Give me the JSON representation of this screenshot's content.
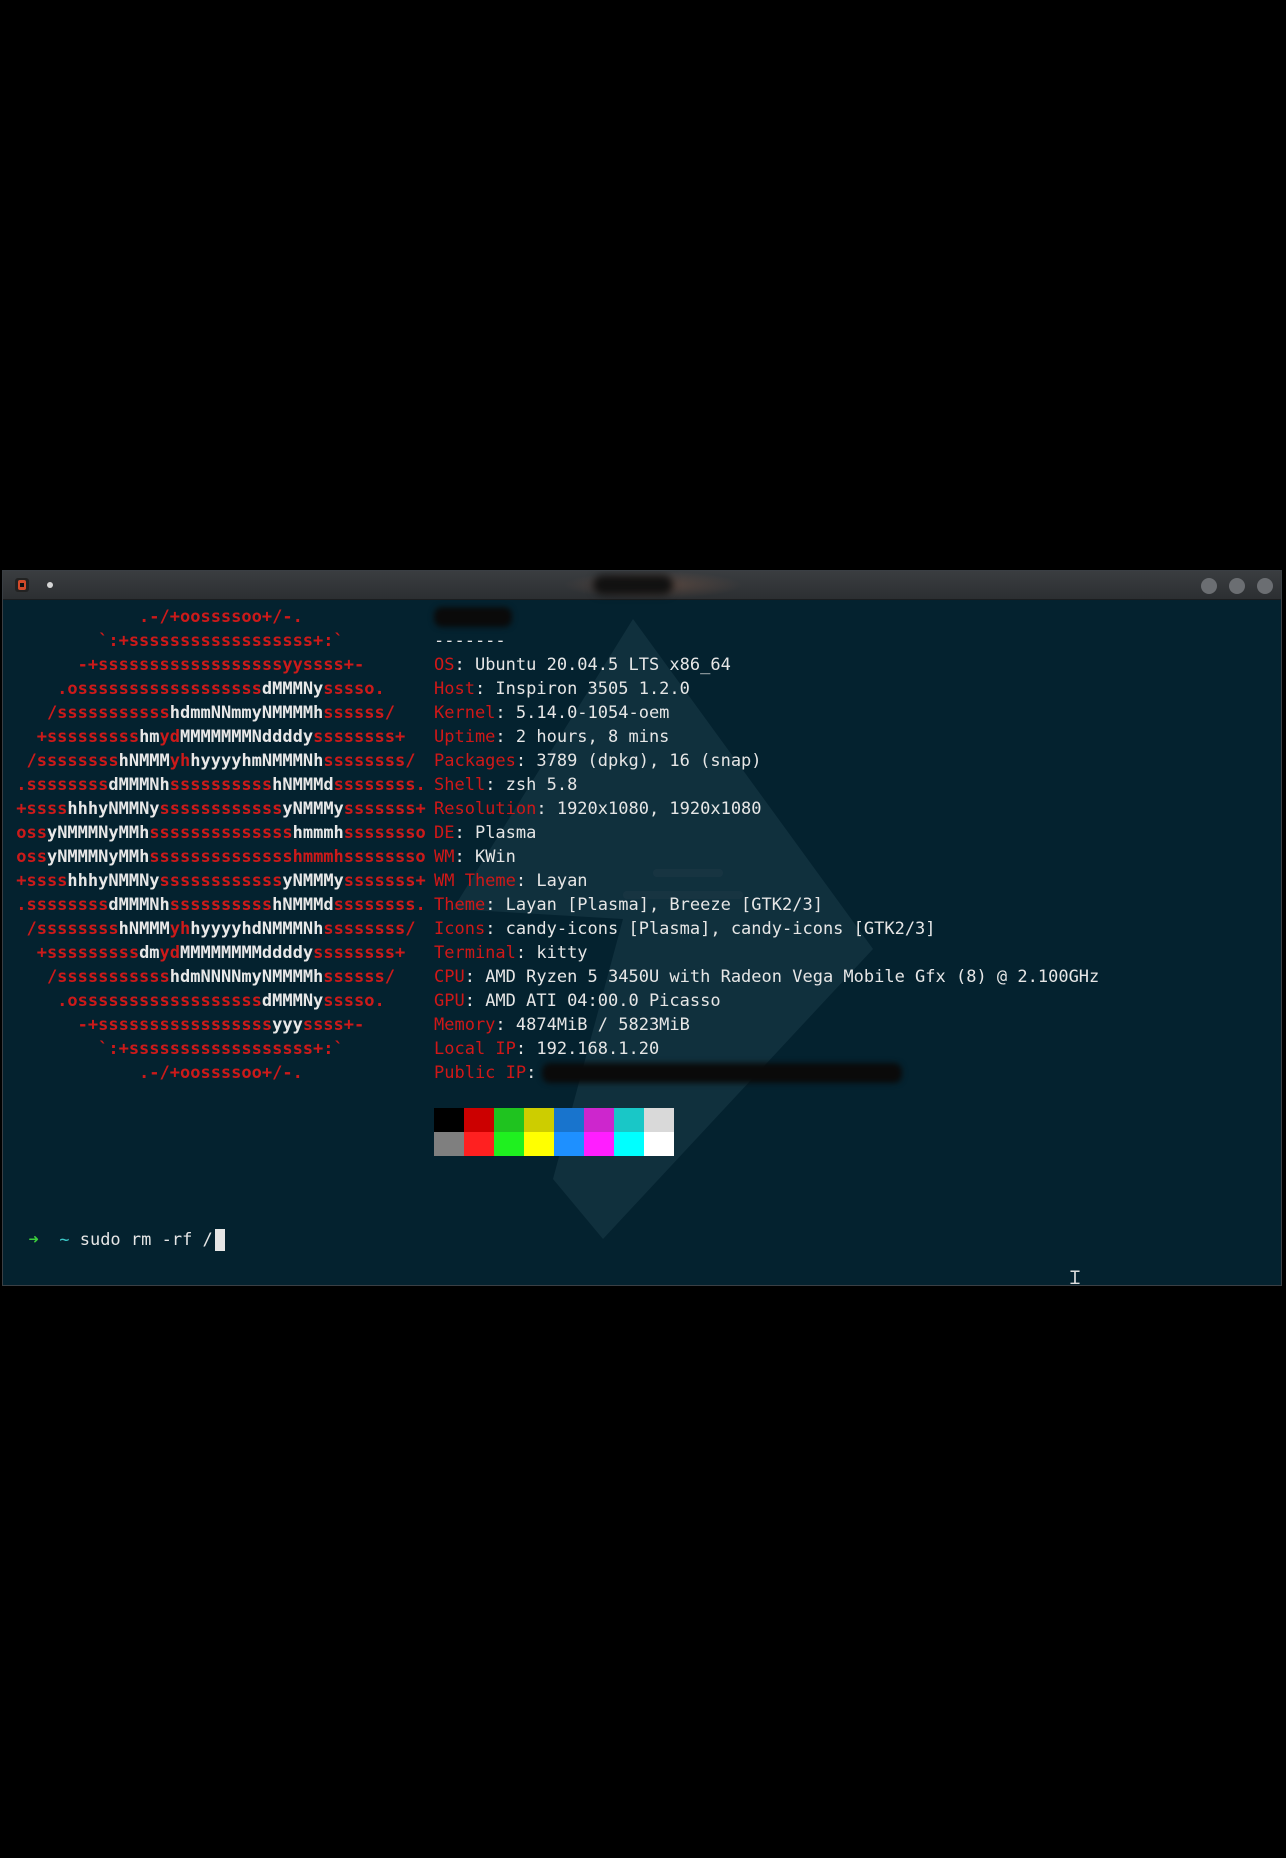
{
  "window": {
    "title": "",
    "controls": [
      "minimize",
      "maximize",
      "close"
    ]
  },
  "ascii_logo": [
    [
      [
        "r",
        "             .-/+oossssoo+/-."
      ]
    ],
    [
      [
        "r",
        "         `:+ssssssssssssssssss+:`"
      ]
    ],
    [
      [
        "r",
        "       -+ssssssssssssssssssyyssss+-"
      ]
    ],
    [
      [
        "r",
        "     .ossssssssssssssssss"
      ],
      [
        "w",
        "dMMMNy"
      ],
      [
        "r",
        "sssso."
      ]
    ],
    [
      [
        "r",
        "    /sssssssssss"
      ],
      [
        "w",
        "hdmmNNmmyNMMMMh"
      ],
      [
        "r",
        "ssssss/"
      ]
    ],
    [
      [
        "r",
        "   +sssssssss"
      ],
      [
        "w",
        "hm"
      ],
      [
        "r",
        "yd"
      ],
      [
        "w",
        "MMMMMMMNddddy"
      ],
      [
        "r",
        "ssssssss+"
      ]
    ],
    [
      [
        "r",
        "  /ssssssss"
      ],
      [
        "w",
        "hNMMM"
      ],
      [
        "r",
        "yh"
      ],
      [
        "w",
        "hyyyyhmNMMMNh"
      ],
      [
        "r",
        "ssssssss/"
      ]
    ],
    [
      [
        "r",
        " .ssssssss"
      ],
      [
        "w",
        "dMMMNh"
      ],
      [
        "r",
        "ssssssssss"
      ],
      [
        "w",
        "hNMMMd"
      ],
      [
        "r",
        "ssssssss."
      ]
    ],
    [
      [
        "r",
        " +ssss"
      ],
      [
        "w",
        "hhhyNMMNy"
      ],
      [
        "r",
        "ssssssssssss"
      ],
      [
        "w",
        "yNMMMy"
      ],
      [
        "r",
        "sssssss+"
      ]
    ],
    [
      [
        "r",
        " oss"
      ],
      [
        "w",
        "yNMMMNyMMh"
      ],
      [
        "r",
        "ssssssssssssss"
      ],
      [
        "w",
        "hmmmh"
      ],
      [
        "r",
        "ssssssso"
      ]
    ],
    [
      [
        "r",
        " oss"
      ],
      [
        "w",
        "yNMMMNyMMh"
      ],
      [
        "r",
        "sssssssssssssshmmmhssssssso"
      ]
    ],
    [
      [
        "r",
        " +ssss"
      ],
      [
        "w",
        "hhhyNMMNy"
      ],
      [
        "r",
        "ssssssssssss"
      ],
      [
        "w",
        "yNMMMy"
      ],
      [
        "r",
        "sssssss+"
      ]
    ],
    [
      [
        "r",
        " .ssssssss"
      ],
      [
        "w",
        "dMMMNh"
      ],
      [
        "r",
        "ssssssssss"
      ],
      [
        "w",
        "hNMMMd"
      ],
      [
        "r",
        "ssssssss."
      ]
    ],
    [
      [
        "r",
        "  /ssssssss"
      ],
      [
        "w",
        "hNMMM"
      ],
      [
        "r",
        "yh"
      ],
      [
        "w",
        "hyyyyhdNMMMNh"
      ],
      [
        "r",
        "ssssssss/"
      ]
    ],
    [
      [
        "r",
        "   +sssssssss"
      ],
      [
        "w",
        "dm"
      ],
      [
        "r",
        "yd"
      ],
      [
        "w",
        "MMMMMMMMddddy"
      ],
      [
        "r",
        "ssssssss+"
      ]
    ],
    [
      [
        "r",
        "    /sssssssssss"
      ],
      [
        "w",
        "hdmNNNNmyNMMMMh"
      ],
      [
        "r",
        "ssssss/"
      ]
    ],
    [
      [
        "r",
        "     .ossssssssssssssssss"
      ],
      [
        "w",
        "dMMMNy"
      ],
      [
        "r",
        "sssso."
      ]
    ],
    [
      [
        "r",
        "       -+sssssssssssssssss"
      ],
      [
        "w",
        "yyy"
      ],
      [
        "r",
        "ssss+-"
      ]
    ],
    [
      [
        "r",
        "         `:+ssssssssssssssssss+:`"
      ]
    ],
    [
      [
        "r",
        "             .-/+oossssoo+/-."
      ]
    ]
  ],
  "info": {
    "separator": "-------",
    "rows": [
      {
        "key": "OS",
        "value": ": Ubuntu 20.04.5 LTS x86_64"
      },
      {
        "key": "Host",
        "value": ": Inspiron 3505 1.2.0"
      },
      {
        "key": "Kernel",
        "value": ": 5.14.0-1054-oem"
      },
      {
        "key": "Uptime",
        "value": ": 2 hours, 8 mins"
      },
      {
        "key": "Packages",
        "value": ": 3789 (dpkg), 16 (snap)"
      },
      {
        "key": "Shell",
        "value": ": zsh 5.8"
      },
      {
        "key": "Resolution",
        "value": ": 1920x1080, 1920x1080"
      },
      {
        "key": "DE",
        "value": ": Plasma"
      },
      {
        "key": "WM",
        "value": ": KWin"
      },
      {
        "key": "WM Theme",
        "value": ": Layan"
      },
      {
        "key": "Theme",
        "value": ": Layan [Plasma], Breeze [GTK2/3]"
      },
      {
        "key": "Icons",
        "value": ": candy-icons [Plasma], candy-icons [GTK2/3]"
      },
      {
        "key": "Terminal",
        "value": ": kitty"
      },
      {
        "key": "CPU",
        "value": ": AMD Ryzen 5 3450U with Radeon Vega Mobile Gfx (8) @ 2.100GHz"
      },
      {
        "key": "GPU",
        "value": ": AMD ATI 04:00.0 Picasso"
      },
      {
        "key": "Memory",
        "value": ": 4874MiB / 5823MiB"
      },
      {
        "key": "Local IP",
        "value": ": 192.168.1.20"
      },
      {
        "key": "Public IP",
        "value": ":"
      }
    ]
  },
  "palette": {
    "normal": [
      "#000000",
      "#cc0000",
      "#1fc31f",
      "#cdcd00",
      "#1874cd",
      "#cd26cd",
      "#19c7c7",
      "#d9d9d9"
    ],
    "bright": [
      "#7f7f7f",
      "#ff2020",
      "#1ff01f",
      "#ffff00",
      "#1e90ff",
      "#ff1eff",
      "#00ffff",
      "#ffffff"
    ]
  },
  "prompt": {
    "arrow": "➜",
    "dir": "~",
    "command": "sudo rm -rf /"
  },
  "colors": {
    "terminal_bg": "#04222f",
    "accent_red": "#d01818",
    "text": "#e6e6e6"
  }
}
